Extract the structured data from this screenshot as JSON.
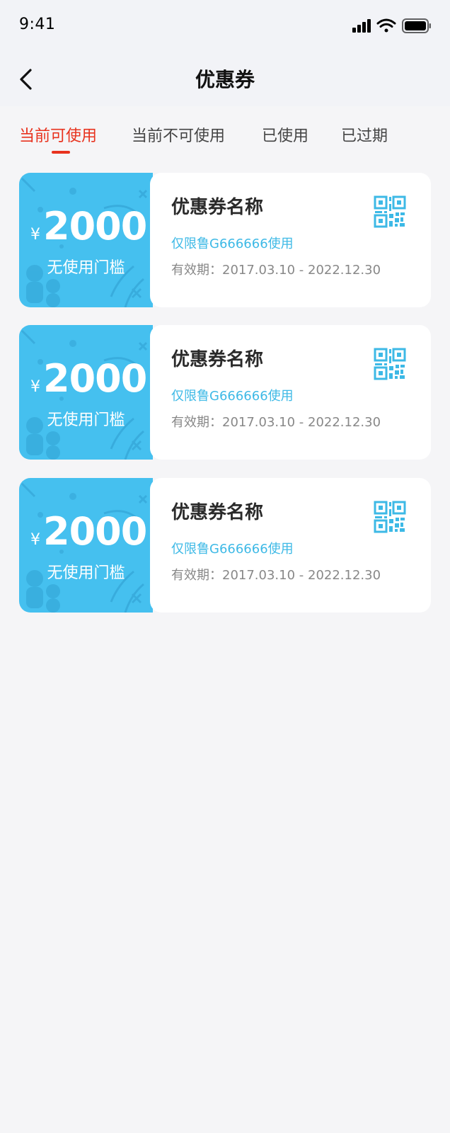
{
  "status_bar": {
    "time": "9:41"
  },
  "nav": {
    "title": "优惠券"
  },
  "tabs": [
    {
      "label": "当前可使用",
      "active": true
    },
    {
      "label": "当前不可使用",
      "active": false
    },
    {
      "label": "已使用",
      "active": false
    },
    {
      "label": "已过期",
      "active": false
    }
  ],
  "colors": {
    "accent": "#e8321e",
    "coupon_blue": "#45c0ef",
    "link_blue": "#3db9e6"
  },
  "coupons": [
    {
      "currency": "¥",
      "amount": "2000",
      "threshold": "无使用门槛",
      "name": "优惠券名称",
      "limit": "仅限鲁G666666使用",
      "valid": "有效期：2017.03.10 - 2022.12.30",
      "icon": "qr-code-icon"
    },
    {
      "currency": "¥",
      "amount": "2000",
      "threshold": "无使用门槛",
      "name": "优惠券名称",
      "limit": "仅限鲁G666666使用",
      "valid": "有效期：2017.03.10 - 2022.12.30",
      "icon": "qr-code-icon"
    },
    {
      "currency": "¥",
      "amount": "2000",
      "threshold": "无使用门槛",
      "name": "优惠券名称",
      "limit": "仅限鲁G666666使用",
      "valid": "有效期：2017.03.10 - 2022.12.30",
      "icon": "qr-code-icon"
    }
  ]
}
